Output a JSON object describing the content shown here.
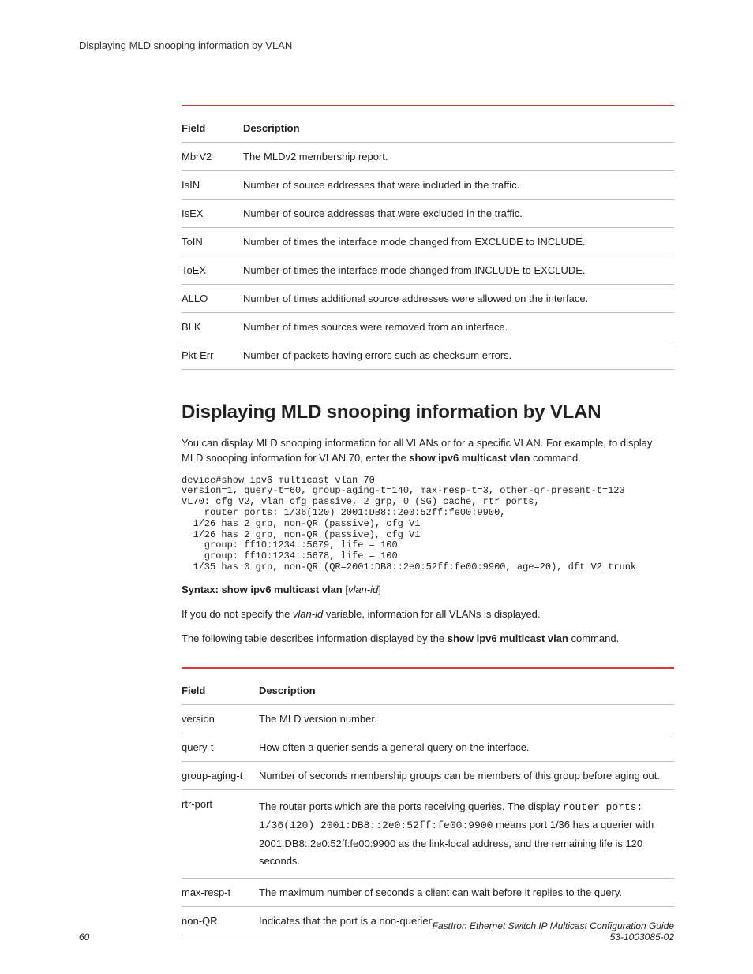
{
  "running_header": "Displaying MLD snooping information by VLAN",
  "table1": {
    "headers": [
      "Field",
      "Description"
    ],
    "rows": [
      [
        "MbrV2",
        "The MLDv2 membership report."
      ],
      [
        "IsIN",
        "Number of source addresses that were included in the traffic."
      ],
      [
        "IsEX",
        "Number of source addresses that were excluded in the traffic."
      ],
      [
        "ToIN",
        "Number of times the interface mode changed from EXCLUDE to INCLUDE."
      ],
      [
        "ToEX",
        "Number of times the interface mode changed from INCLUDE to EXCLUDE."
      ],
      [
        "ALLO",
        "Number of times additional source addresses were allowed on the interface."
      ],
      [
        "BLK",
        "Number of times sources were removed from an interface."
      ],
      [
        "Pkt-Err",
        "Number of packets having errors such as checksum errors."
      ]
    ]
  },
  "section_title": "Displaying MLD snooping information by VLAN",
  "intro": {
    "p1a": "You can display MLD snooping information for all VLANs or for a specific VLAN. For example, to display MLD snooping information for VLAN 70, enter the ",
    "p1b_bold": "show ipv6 multicast vlan",
    "p1c": " command."
  },
  "code_block": "device#show ipv6 multicast vlan 70\nversion=1, query-t=60, group-aging-t=140, max-resp-t=3, other-qr-present-t=123\nVL70: cfg V2, vlan cfg passive, 2 grp, 0 (SG) cache, rtr ports,\n    router ports: 1/36(120) 2001:DB8::2e0:52ff:fe00:9900,\n  1/26 has 2 grp, non-QR (passive), cfg V1\n  1/26 has 2 grp, non-QR (passive), cfg V1\n    group: ff10:1234::5679, life = 100\n    group: ff10:1234::5678, life = 100\n  1/35 has 0 grp, non-QR (QR=2001:DB8::2e0:52ff:fe00:9900, age=20), dft V2 trunk",
  "syntax": {
    "label": "Syntax: show ipv6 multicast vlan ",
    "brk_open": "[",
    "var": "vlan-id",
    "brk_close": "]"
  },
  "para2": {
    "a": "If you do not specify the ",
    "var": "vlan-id",
    "b": " variable, information for all VLANs is displayed."
  },
  "para3": {
    "a": "The following table describes information displayed by the ",
    "bold": "show ipv6 multicast vlan",
    "b": " command."
  },
  "table2": {
    "headers": [
      "Field",
      "Description"
    ],
    "rows": [
      {
        "field": "version",
        "plain": "The MLD version number."
      },
      {
        "field": "query-t",
        "plain": "How often a querier sends a general query on the interface."
      },
      {
        "field": "group-aging-t",
        "plain": "Number of seconds membership groups can be members of this group before aging out."
      },
      {
        "field": "rtr-port",
        "rich": {
          "a": "The router ports which are the ports receiving queries. The display ",
          "mono1": "router ports: 1/36(120) 2001:DB8::2e0:52ff:fe00:9900",
          "b": " means port 1/36 has a querier with 2001:DB8::2e0:52ff:fe00:9900 as the link-local address, and the remaining life is 120 seconds."
        }
      },
      {
        "field": "max-resp-t",
        "plain": "The maximum number of seconds a client can wait before it replies to the query."
      },
      {
        "field": "non-QR",
        "plain": "Indicates that the port is a non-querier."
      }
    ]
  },
  "footer": {
    "page_number": "60",
    "doc_title": "FastIron Ethernet Switch IP Multicast Configuration Guide",
    "doc_number": "53-1003085-02"
  }
}
